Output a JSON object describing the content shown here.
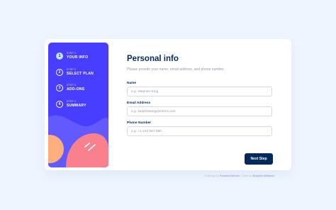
{
  "sidebar": {
    "steps": [
      {
        "number": "1",
        "label": "STEP 1",
        "title": "YOUR INFO"
      },
      {
        "number": "2",
        "label": "STEP 2",
        "title": "SELECT PLAN"
      },
      {
        "number": "3",
        "label": "STEP 3",
        "title": "ADD-ONS"
      },
      {
        "number": "4",
        "label": "STEP 4",
        "title": "SUMMARY"
      }
    ],
    "active_step": 1
  },
  "main": {
    "title": "Personal info",
    "subtitle": "Please provide your name, email address, and phone number.",
    "fields": [
      {
        "label": "Name",
        "placeholder": "e.g. Stephen King",
        "value": ""
      },
      {
        "label": "Email Address",
        "placeholder": "e.g. stephenking@lorem.com",
        "value": ""
      },
      {
        "label": "Phone Number",
        "placeholder": "e.g. +1 234 567 890",
        "value": ""
      }
    ],
    "next_button": "Next Step"
  },
  "attribution": {
    "prefix": "Challenge by",
    "challenge_link": "Frontend Mentor",
    "separator": ". Coded by",
    "author_link": "Brayden Williams"
  },
  "colors": {
    "sidebar_bg": "#483eff",
    "active_step_bg": "#bee2fd",
    "primary_text": "#02295a",
    "button_bg": "#02295a",
    "muted_text": "#9699ab",
    "border": "#d6d9e6",
    "page_bg": "#eef5ff",
    "decor_pink": "#f9818e",
    "decor_orange": "#ffaf7e",
    "decor_purple": "#6259ff"
  }
}
